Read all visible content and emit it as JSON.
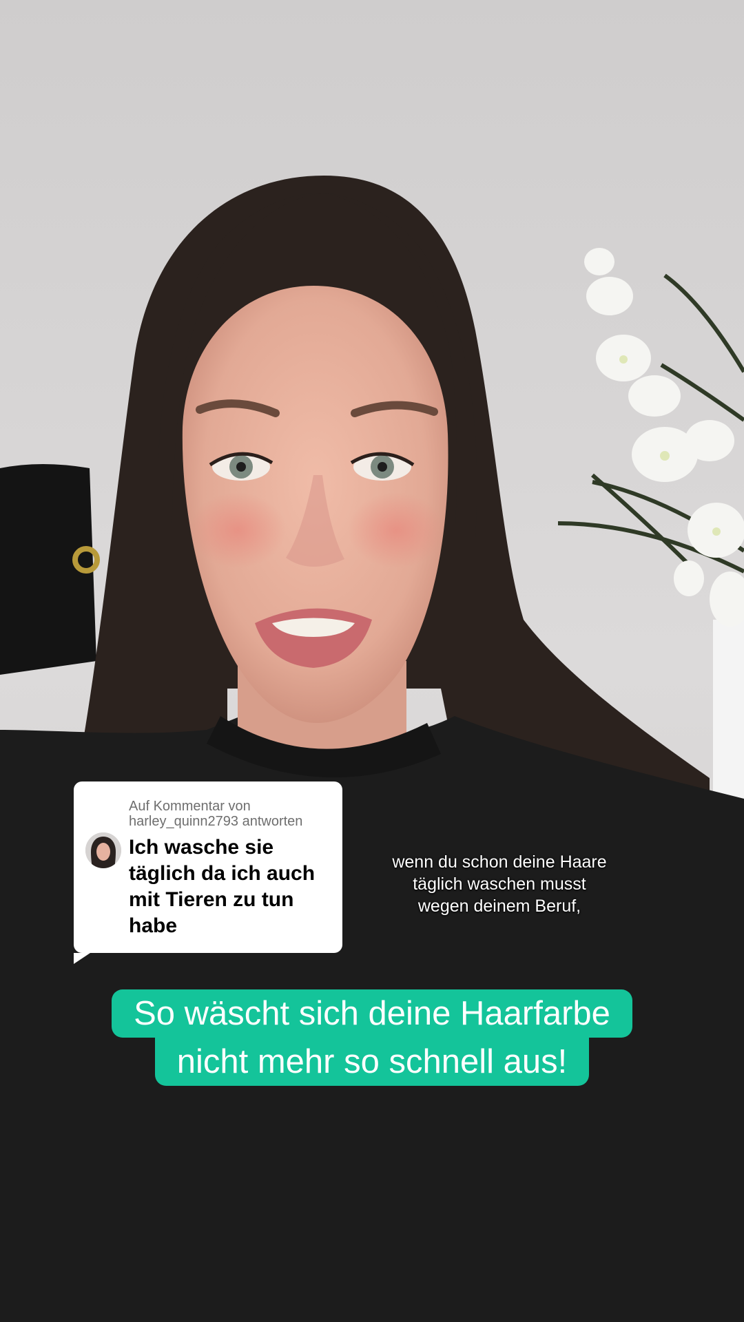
{
  "reply_sticker": {
    "meta_line1": "Auf Kommentar von",
    "meta_line2": "harley_quinn2793 antworten",
    "comment_text": "Ich wasche sie täglich da ich auch mit Tieren zu tun habe"
  },
  "caption": {
    "text": "wenn du schon deine Haare täglich waschen musst wegen deinem Beruf,"
  },
  "headline": {
    "line1": "So wäscht sich deine Haarfarbe",
    "line2": "nicht mehr so schnell aus!"
  },
  "colors": {
    "headline_bg": "#14c49a",
    "wall": "#d8d6d6",
    "hoodie": "#1b1b1b",
    "hair": "#2a211d",
    "skin": "#e7b09d"
  }
}
